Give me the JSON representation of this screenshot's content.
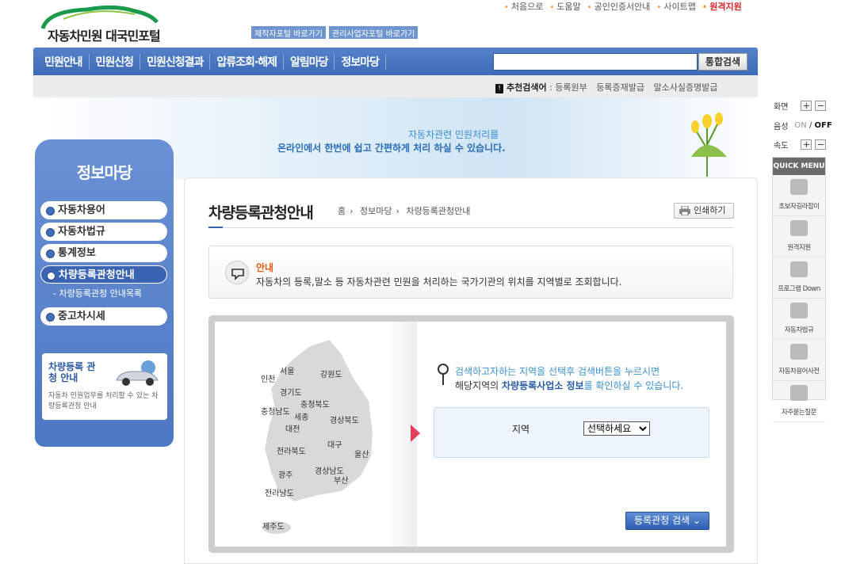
{
  "utils": {
    "items": [
      "처음으로",
      "도움말",
      "공인인증서안내",
      "사이트맵"
    ],
    "highlight": "원격지원"
  },
  "logo": {
    "text": "자동차민원 대국민포털"
  },
  "portal_buttons": [
    "제작자포털 바로가기",
    "관리사업자포털 바로가기"
  ],
  "nav": {
    "items": [
      "민원안내",
      "민원신청",
      "민원신청결과",
      "압류조회·해제",
      "알림마당",
      "정보마당"
    ],
    "search_placeholder": "",
    "search_button": "통합검색"
  },
  "recommend": {
    "label": "추천검색어",
    "keywords": [
      "등록원부",
      "등록증재발급",
      "말소사실증명발급"
    ]
  },
  "banner": {
    "line1": "자동차관련 민원처리를",
    "line2": "온라인에서 한번에 쉽고 간편하게 처리 하실 수 있습니다."
  },
  "sidebar": {
    "title": "정보마당",
    "items": [
      "자동차용어",
      "자동차법규",
      "통계정보",
      "차량등록관청안내",
      "중고차시세"
    ],
    "active_index": 3,
    "sub_item": "차량등록관청 안내목록",
    "info_title": "차량등록 관청 안내",
    "info_desc": "자동차 민원업무를 처리할 수 있는 차량등록관청 안내"
  },
  "main": {
    "title": "차량등록관청안내",
    "breadcrumb": [
      "홈",
      "정보마당",
      "차량등록관청안내"
    ],
    "print": "인쇄하기",
    "notice_title": "안내",
    "notice_text": "자동차의 등록,말소 등 자동차관련 민원을 처리하는 국가기관의 위치를 지역별로 조회합니다.",
    "map_regions": [
      "서울",
      "인천",
      "강원도",
      "경기도",
      "충청북도",
      "충청남도",
      "세종",
      "대전",
      "경상북도",
      "대구",
      "전라북도",
      "울산",
      "광주",
      "경상남도",
      "부산",
      "전라남도",
      "제주도"
    ],
    "guide1": "검색하고자하는 지역을 선택후 검색버튼을 누르시면",
    "guide2_pre": "해당지역의 ",
    "guide2_bold": "차량등록사업소 정보",
    "guide2_post": "를 확인하실 수 있습니다.",
    "region_label": "지역",
    "region_select": "선택하세요",
    "search_button": "등록관청 검색"
  },
  "right": {
    "screen_label": "화면",
    "voice_label": "음성",
    "voice_on": "ON",
    "voice_off": "OFF",
    "speed_label": "속도",
    "quick_title": "QUICK MENU",
    "quick_items": [
      "초보자길라잡이",
      "원격지원",
      "프로그램 Down",
      "자동차법규",
      "자동차용어사전",
      "자주묻는질문"
    ]
  },
  "colors": {
    "nav_blue": "#3c6ab7",
    "accent_orange": "#e9590e",
    "accent_red": "#d8262b"
  }
}
